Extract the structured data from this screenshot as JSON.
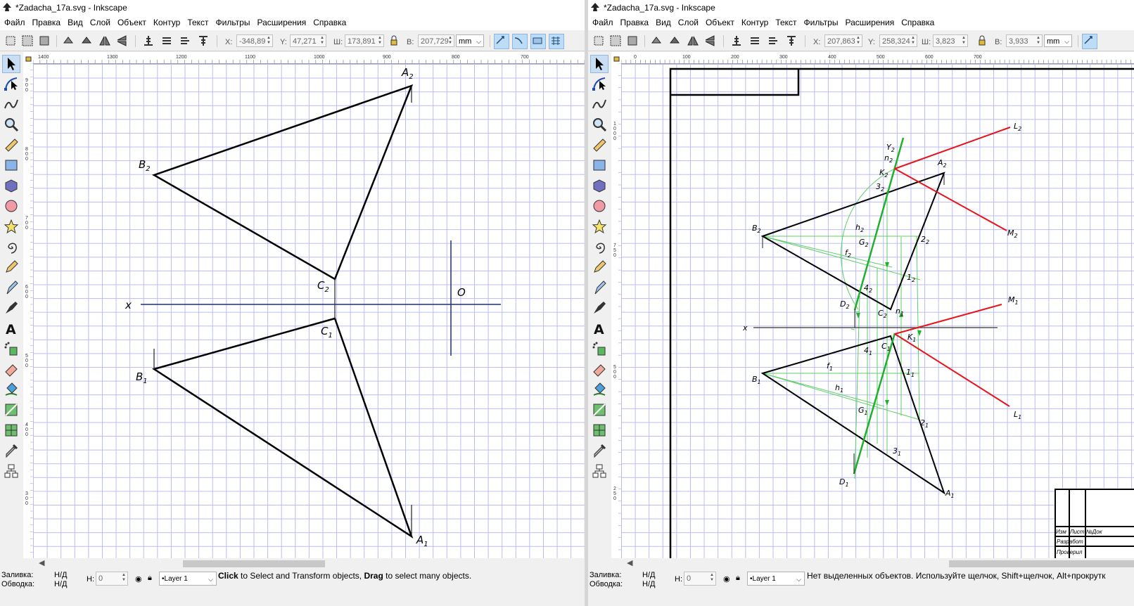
{
  "left": {
    "title": "*Zadacha_17a.svg - Inkscape",
    "menu": [
      "Файл",
      "Правка",
      "Вид",
      "Слой",
      "Объект",
      "Контур",
      "Текст",
      "Фильтры",
      "Расширения",
      "Справка"
    ],
    "toolbar": {
      "x_label": "X:",
      "x_value": "-348,89",
      "y_label": "Y:",
      "y_value": "47,271",
      "w_label": "Ш:",
      "w_value": "173,891",
      "h_label": "В:",
      "h_value": "207,729",
      "unit": "mm"
    },
    "ruler_labels": [
      "1400",
      "1300",
      "1200",
      "1100",
      "1000",
      "900",
      "800",
      "700"
    ],
    "vruler_labels": [
      "900",
      "800",
      "700",
      "600",
      "500",
      "400",
      "300"
    ],
    "canvas_labels": {
      "A2": "A",
      "A2_sub": "2",
      "B2": "B",
      "B2_sub": "2",
      "C2": "C",
      "C2_sub": "2",
      "A1": "A",
      "A1_sub": "1",
      "B1": "B",
      "B1_sub": "1",
      "C1": "C",
      "C1_sub": "1",
      "x": "x",
      "O": "O"
    },
    "status": {
      "fill_label": "Заливка:",
      "fill_value": "Н/Д",
      "stroke_label": "Обводка:",
      "stroke_value": "Н/Д",
      "h_label": "Н:",
      "h_value": "0",
      "layer": "•Layer 1",
      "message_parts": [
        "Click",
        " to Select and Transform objects, ",
        "Drag",
        " to select many objects."
      ]
    }
  },
  "right": {
    "title": "*Zadacha_17a.svg - Inkscape",
    "menu": [
      "Файл",
      "Правка",
      "Вид",
      "Слой",
      "Объект",
      "Контур",
      "Текст",
      "Фильтры",
      "Расширения",
      "Справка"
    ],
    "toolbar": {
      "x_label": "X:",
      "x_value": "207,863",
      "y_label": "Y:",
      "y_value": "258,324",
      "w_label": "Ш:",
      "w_value": "3,823",
      "h_label": "В:",
      "h_value": "3,933",
      "unit": "mm"
    },
    "ruler_labels": [
      "0",
      "100",
      "200",
      "300",
      "400",
      "500",
      "600",
      "700"
    ],
    "vruler_labels": [
      "1000",
      "750",
      "500",
      "250"
    ],
    "canvas_labels": {
      "L2": "L",
      "L2_sub": "2",
      "M2": "M",
      "M2_sub": "2",
      "Y2": "Y",
      "Y2_sub": "2",
      "n2": "n",
      "n2_sub": "2",
      "K2": "K",
      "K2_sub": "2",
      "A2": "A",
      "A2_sub": "2",
      "32": "3",
      "32_sub": "2",
      "B2": "B",
      "B2_sub": "2",
      "h2": "h",
      "h2_sub": "2",
      "22": "2",
      "22_sub": "2",
      "G2": "G",
      "G2_sub": "2",
      "f2": "f",
      "f2_sub": "2",
      "12": "1",
      "12_sub": "2",
      "42": "4",
      "42_sub": "2",
      "D2": "D",
      "D2_sub": "2",
      "C2": "C",
      "C2_sub": "2",
      "n1": "n",
      "n1_sub": "1",
      "M1": "M",
      "M1_sub": "1",
      "x": "x",
      "C1": "C",
      "C1_sub": "1",
      "K1": "K",
      "K1_sub": "1",
      "41": "4",
      "41_sub": "1",
      "f1": "f",
      "f1_sub": "1",
      "11": "1",
      "11_sub": "1",
      "B1": "B",
      "B1_sub": "1",
      "h1": "h",
      "h1_sub": "1",
      "G1": "G",
      "G1_sub": "1",
      "L1": "L",
      "L1_sub": "1",
      "21": "2",
      "21_sub": "1",
      "31": "3",
      "31_sub": "1",
      "D1": "D",
      "D1_sub": "1",
      "A1": "A",
      "A1_sub": "1"
    },
    "stamp": {
      "c1": "Изм",
      "c2": "Лист",
      "c3": "№Док",
      "r1": "Разработ",
      "r2": "Проверил"
    },
    "status": {
      "fill_label": "Заливка:",
      "fill_value": "Н/Д",
      "stroke_label": "Обводка:",
      "stroke_value": "Н/Д",
      "h_label": "Н:",
      "h_value": "0",
      "layer": "•Layer 1",
      "message": "Нет выделенных объектов. Используйте щелчок, Shift+щелчок, Alt+прокрутк"
    }
  },
  "colors": {
    "grid": "#b9bbf5",
    "accent": "#bfdcf7",
    "red": "#e8141b",
    "green": "#22b02c",
    "thin_green": "#5fcf66"
  }
}
